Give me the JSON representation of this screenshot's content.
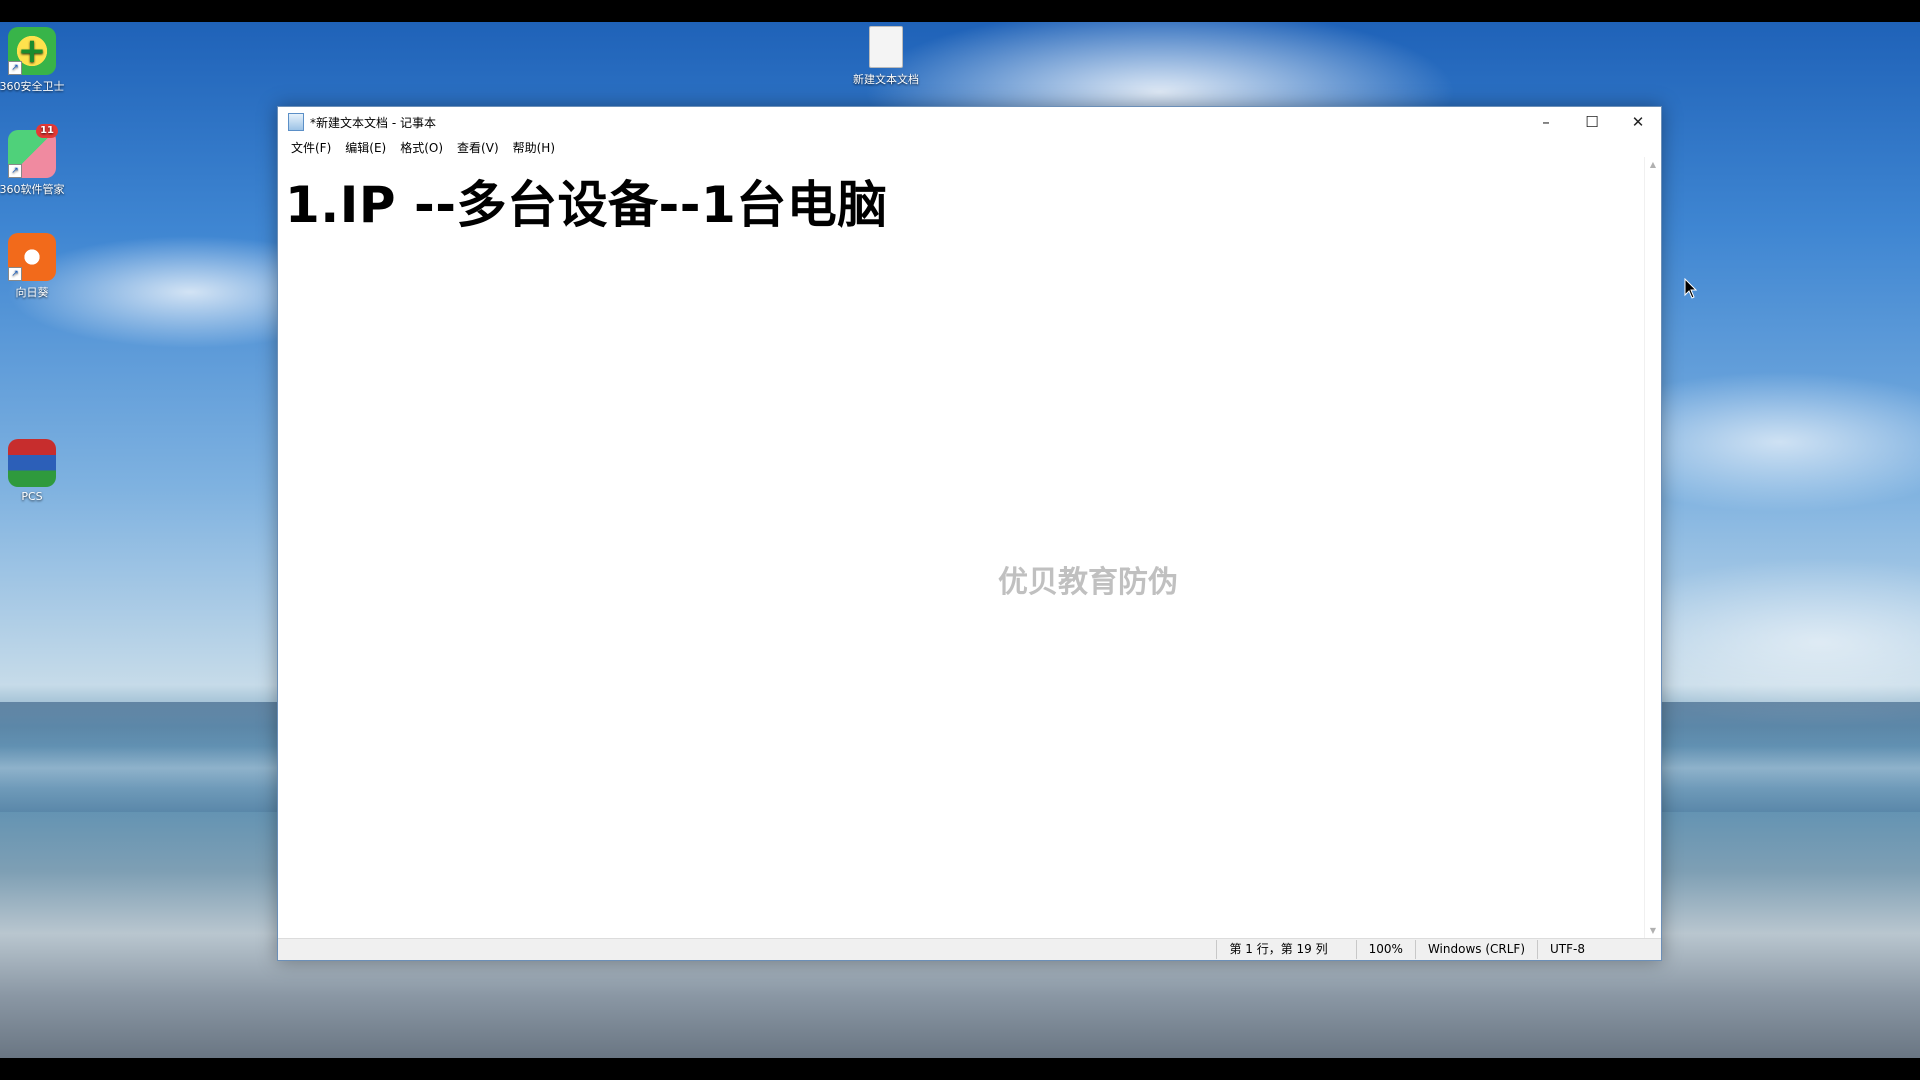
{
  "desktop": {
    "icons": [
      {
        "label": "360安全卫士",
        "icon": "360-safe-icon"
      },
      {
        "label": "360软件管家",
        "icon": "360-software-manager-icon",
        "badge": "11"
      },
      {
        "label": "向日葵",
        "icon": "sunflower-remote-icon"
      },
      {
        "label": "PCS",
        "icon": "winrar-archive-icon"
      }
    ],
    "file_icon": {
      "label": "新建文本文档",
      "icon": "text-document-icon"
    }
  },
  "notepad": {
    "title": "*新建文本文档 - 记事本",
    "controls": {
      "minimize": "–",
      "maximize": "☐",
      "close": "✕"
    },
    "menu": [
      "文件(F)",
      "编辑(E)",
      "格式(O)",
      "查看(V)",
      "帮助(H)"
    ],
    "content": "1.IP  --多台设备--1台电脑",
    "watermark": "优贝教育防伪",
    "status": {
      "position": "第 1 行，第 19 列",
      "zoom": "100%",
      "line_ending": "Windows (CRLF)",
      "encoding": "UTF-8"
    }
  },
  "colors": {
    "window_border": "#6b8fb8",
    "status_bg": "#f0f0f0"
  }
}
